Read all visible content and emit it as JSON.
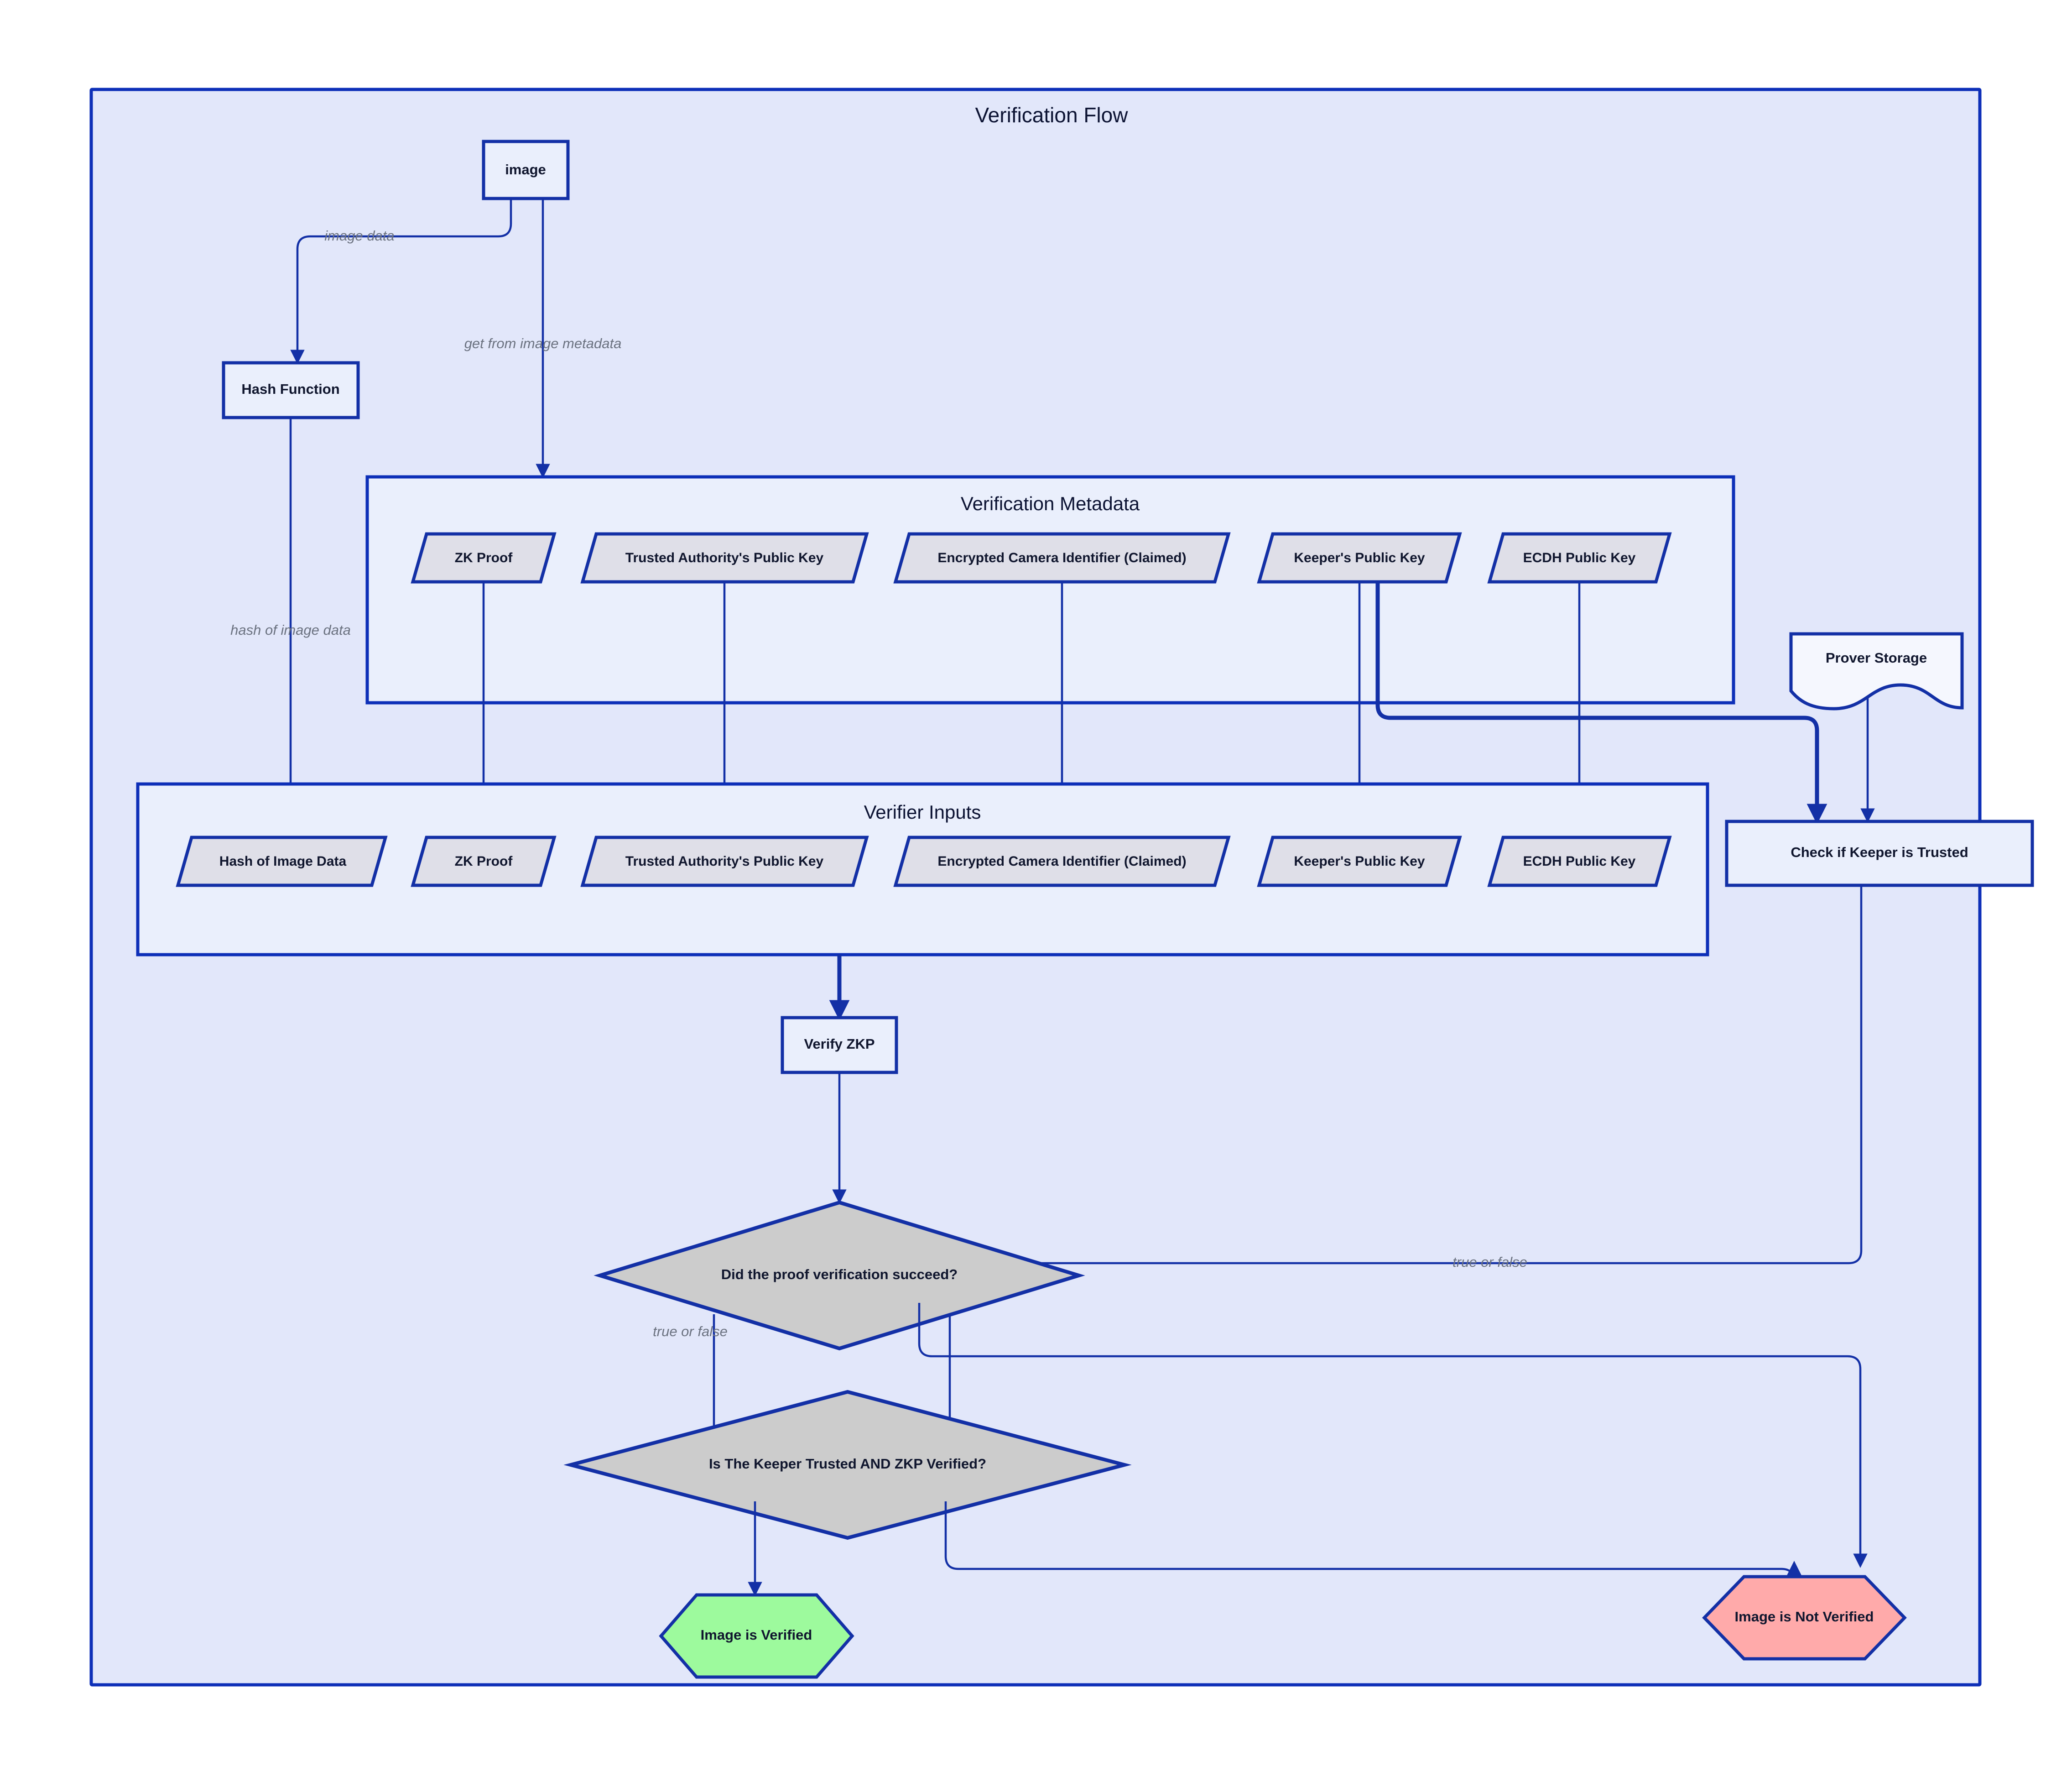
{
  "diagram": {
    "type": "flowchart",
    "title": "Verification Flow",
    "background_color": "#ffffff",
    "frame_fill": "#e2e7fa",
    "frame_stroke": "#0d2fb8",
    "subgraph_fill": "#eaeffc",
    "process_fill": "#eaeffc",
    "data_fill": "#dfdfe8",
    "decision_fill": "#cccccc",
    "success_fill": "#9dfa9d",
    "failure_fill": "#ffaaaa",
    "edge_color": "#1330a6",
    "edge_label_color": "#6b7280"
  },
  "subgraphs": {
    "verification_metadata": {
      "title": "Verification Metadata"
    },
    "verifier_inputs": {
      "title": "Verifier Inputs"
    }
  },
  "nodes": {
    "image": {
      "label": "image",
      "shape": "rectangle"
    },
    "hash_function": {
      "label": "Hash Function",
      "shape": "rectangle"
    },
    "prover_storage": {
      "label": "Prover Storage",
      "shape": "document"
    },
    "check_keeper_trusted": {
      "label": "Check if Keeper is Trusted",
      "shape": "rectangle"
    },
    "verify_zkp": {
      "label": "Verify ZKP",
      "shape": "rectangle"
    },
    "proof_decision": {
      "label": "Did the proof verification succeed?",
      "shape": "diamond"
    },
    "final_decision": {
      "label": "Is The Keeper Trusted AND ZKP Verified?",
      "shape": "diamond"
    },
    "image_verified": {
      "label": "Image is Verified",
      "shape": "hexagon"
    },
    "image_not_verified": {
      "label": "Image is Not Verified",
      "shape": "hexagon"
    }
  },
  "metadata_items": [
    {
      "label": "ZK Proof"
    },
    {
      "label": "Trusted Authority's Public Key"
    },
    {
      "label": "Encrypted Camera Identifier (Claimed)"
    },
    {
      "label": "Keeper's Public Key"
    },
    {
      "label": "ECDH Public Key"
    }
  ],
  "verifier_input_items": [
    {
      "label": "Hash of Image Data"
    },
    {
      "label": "ZK Proof"
    },
    {
      "label": "Trusted Authority's Public Key"
    },
    {
      "label": "Encrypted Camera Identifier (Claimed)"
    },
    {
      "label": "Keeper's Public Key"
    },
    {
      "label": "ECDH Public Key"
    }
  ],
  "edge_labels": {
    "image_data": "image data",
    "get_from_image_metadata": "get from image metadata",
    "hash_of_image_data": "hash of image data",
    "true_or_false_left": "true or false",
    "true_or_false_right": "true or false"
  }
}
